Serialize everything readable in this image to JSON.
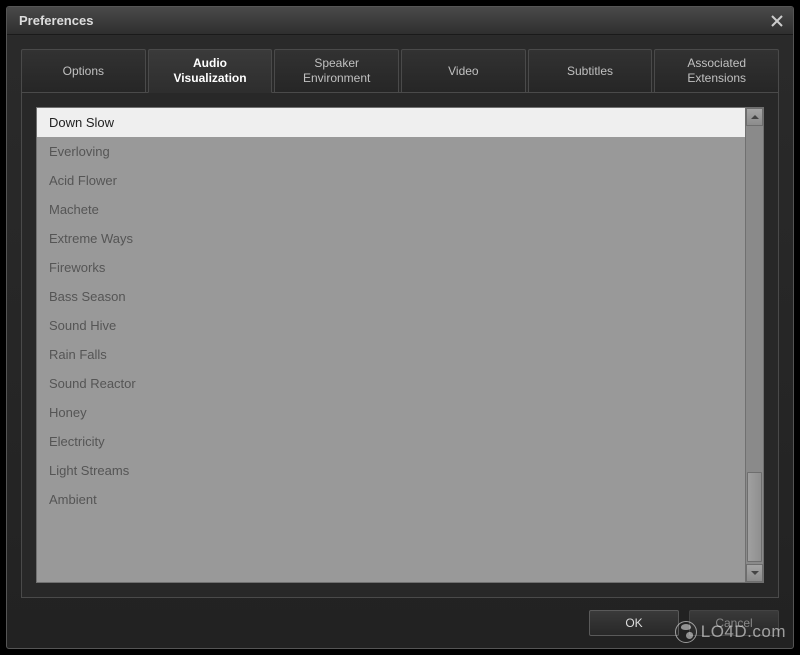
{
  "window": {
    "title": "Preferences"
  },
  "tabs": [
    {
      "label": "Options"
    },
    {
      "label": "Audio\nVisualization"
    },
    {
      "label": "Speaker\nEnvironment"
    },
    {
      "label": "Video"
    },
    {
      "label": "Subtitles"
    },
    {
      "label": "Associated\nExtensions"
    }
  ],
  "active_tab_index": 1,
  "list": {
    "items": [
      "Down Slow",
      "Everloving",
      "Acid Flower",
      "Machete",
      "Extreme Ways",
      "Fireworks",
      "Bass Season",
      "Sound Hive",
      "Rain Falls",
      "Sound Reactor",
      "Honey",
      "Electricity",
      "Light Streams",
      "Ambient"
    ],
    "selected_index": 0
  },
  "buttons": {
    "ok": "OK",
    "cancel": "Cancel"
  },
  "watermark": "LO4D.com"
}
